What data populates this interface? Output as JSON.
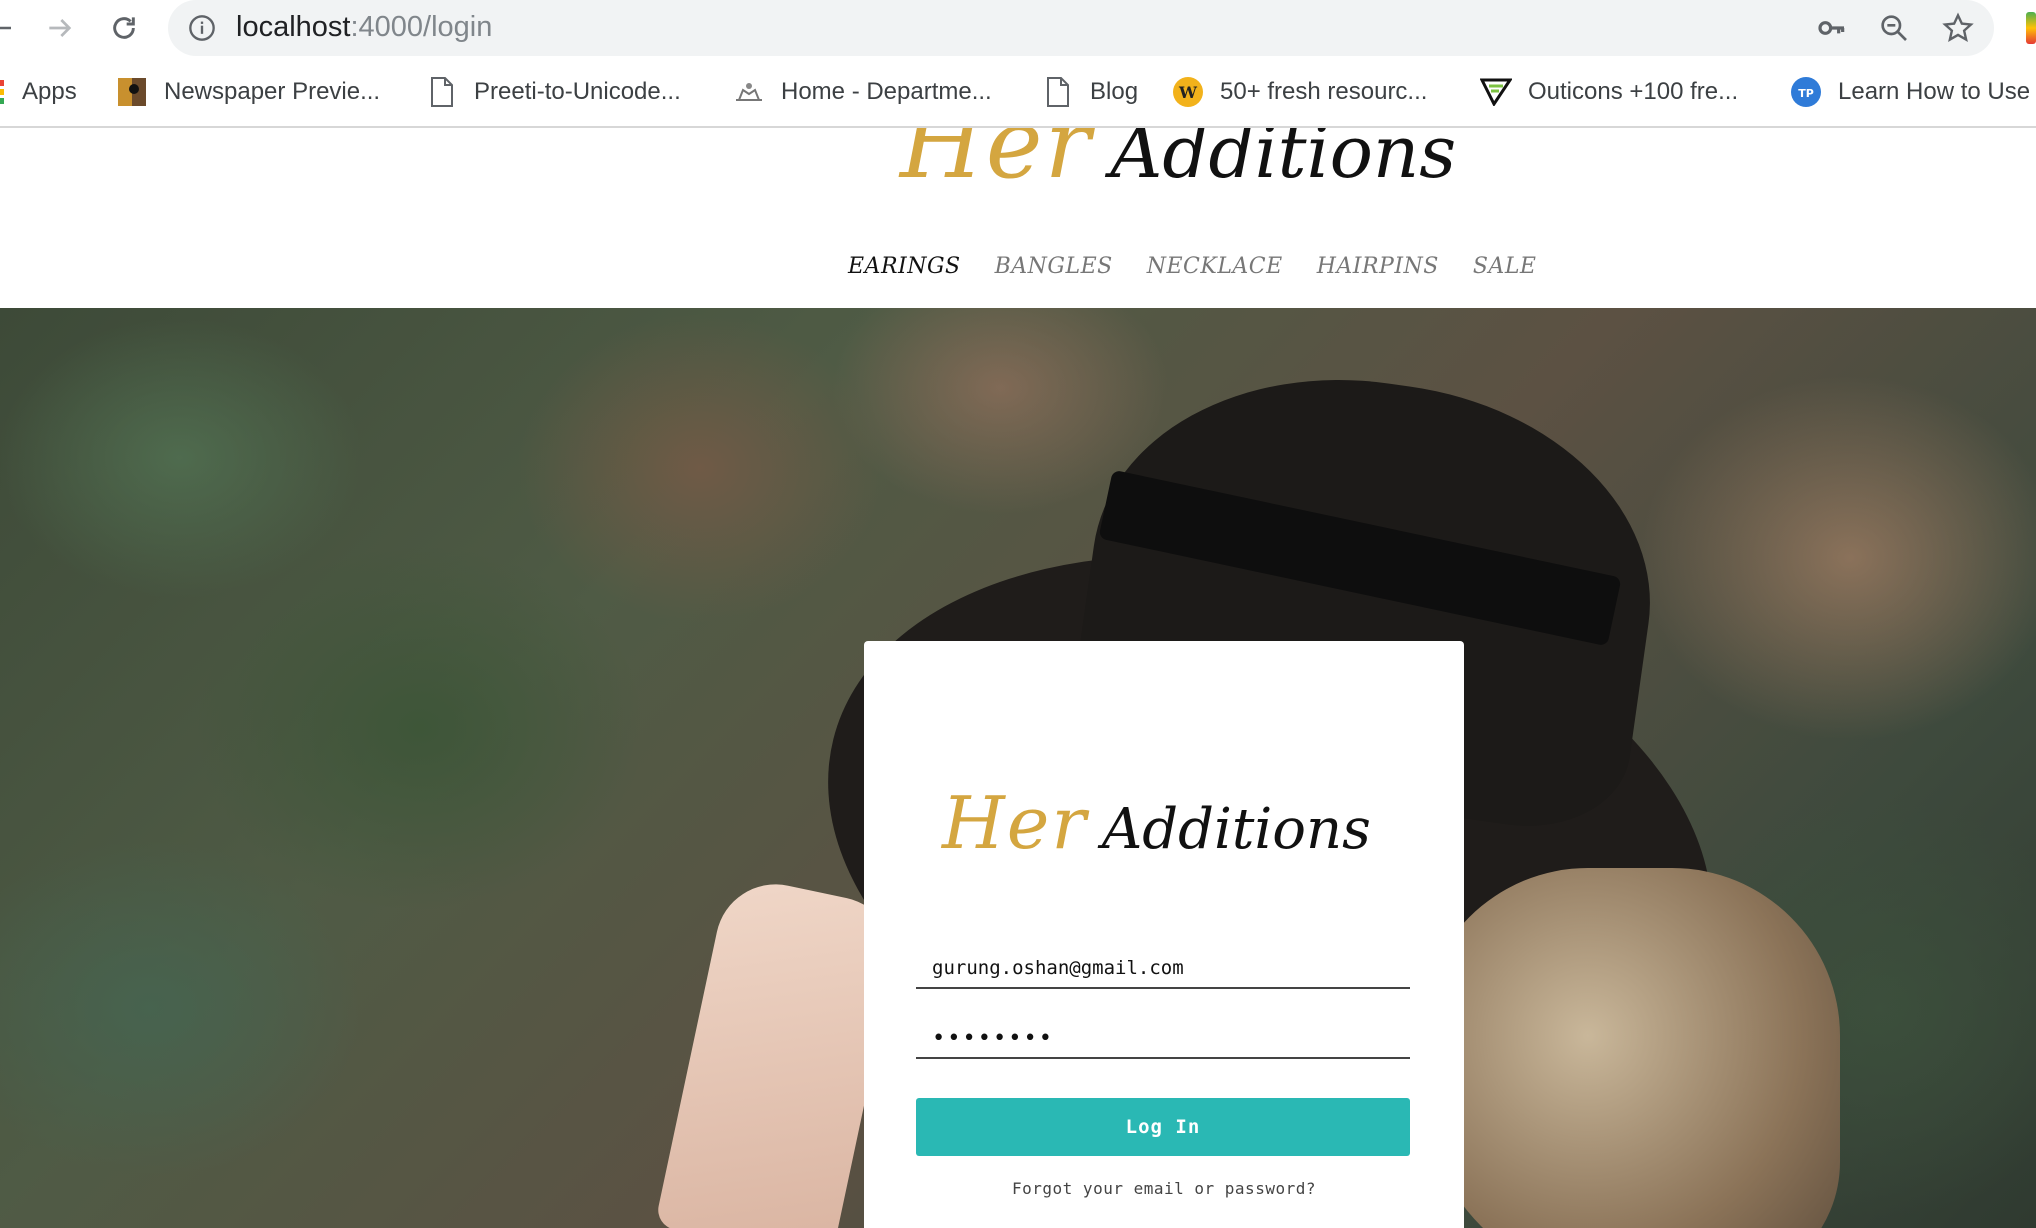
{
  "browser": {
    "url_host": "localhost",
    "url_rest": ":4000/login",
    "bookmarks": [
      {
        "label": "Apps",
        "icon": "apps-grid-icon"
      },
      {
        "label": "Newspaper Previe...",
        "icon": "newspaper-favicon"
      },
      {
        "label": "Preeti-to-Unicode...",
        "icon": "document-icon"
      },
      {
        "label": "Home - Departme...",
        "icon": "emblem-favicon"
      },
      {
        "label": "Blog",
        "icon": "document-icon"
      },
      {
        "label": "50+ fresh resourc...",
        "icon": "w-badge-favicon"
      },
      {
        "label": "Outicons +100 fre...",
        "icon": "outicons-favicon"
      },
      {
        "label": "Learn How to Use",
        "icon": "tp-favicon"
      }
    ]
  },
  "site": {
    "logo_her": "Her",
    "logo_additions": "Additions",
    "nav": [
      "EARINGS",
      "BANGLES",
      "NECKLACE",
      "HAIRPINS",
      "SALE"
    ],
    "active_nav": "EARINGS"
  },
  "login": {
    "logo_her": "Her",
    "logo_additions": "Additions",
    "email_value": "gurung.oshan@gmail.com",
    "password_value": "••••••••",
    "button_label": "Log In",
    "forgot_label": "Forgot your email or password?"
  },
  "colors": {
    "accent_gold": "#d4a640",
    "button_teal": "#2ab8b4"
  }
}
